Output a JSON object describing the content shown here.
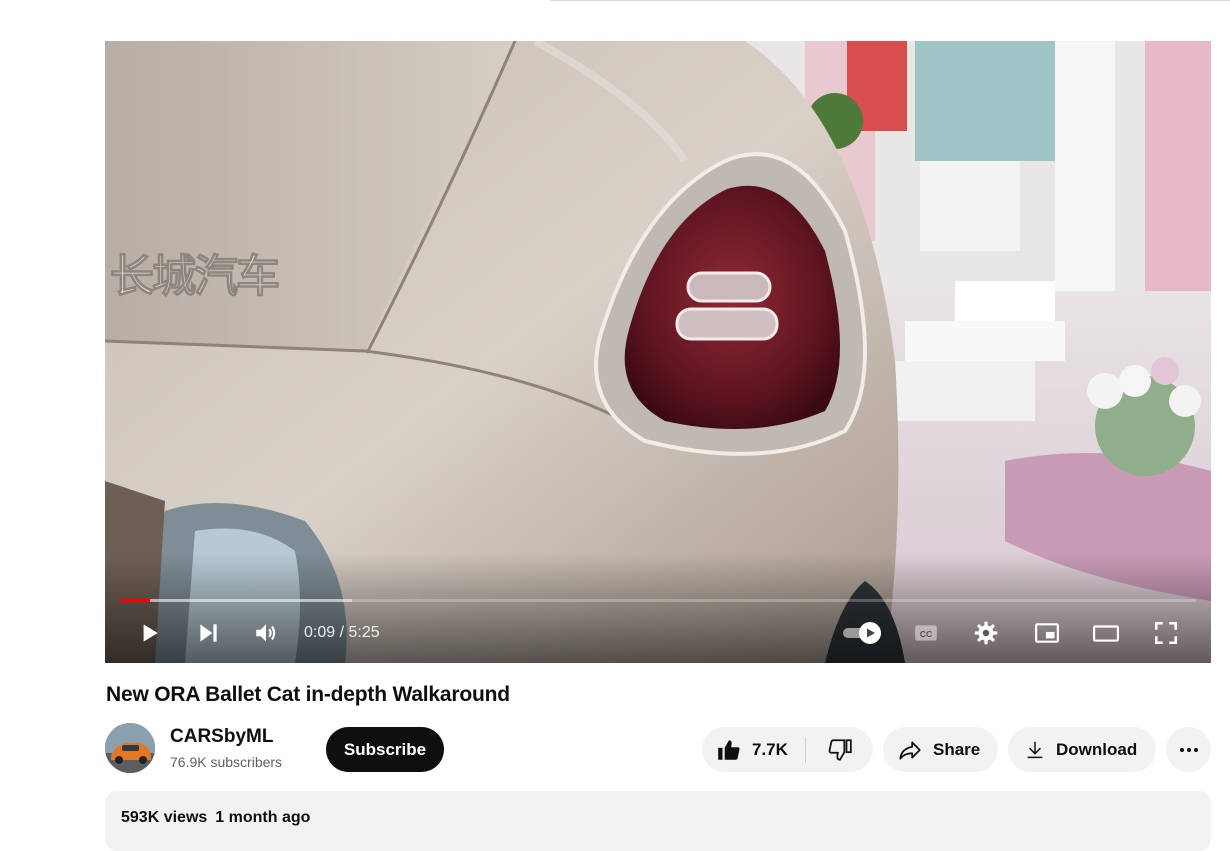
{
  "player": {
    "time_current": "0:09",
    "time_separator": " / ",
    "time_total": "5:25",
    "progress_played_fraction": 0.028,
    "progress_loaded_fraction": 0.216,
    "controls": {
      "play": "play-icon",
      "next": "next-icon",
      "volume": "volume-icon",
      "autoplay": "autoplay-toggle-icon",
      "captions": "captions-icon",
      "settings": "gear-icon",
      "miniplayer": "miniplayer-icon",
      "theater": "theater-mode-icon",
      "fullscreen": "fullscreen-icon"
    },
    "accent_color": "#ff0000"
  },
  "video": {
    "title": "New ORA Ballet Cat in-depth Walkaround"
  },
  "owner": {
    "channel_name": "CARSbyML",
    "subscribers": "76.9K subscribers",
    "subscribe_label": "Subscribe"
  },
  "actions": {
    "like_count": "7.7K",
    "share_label": "Share",
    "download_label": "Download",
    "like_icon": "thumbs-up-icon",
    "dislike_icon": "thumbs-down-icon",
    "share_icon": "share-arrow-icon",
    "download_icon": "download-icon",
    "more_icon": "more-horizontal-icon"
  },
  "description": {
    "views": "593K views",
    "age": "1 month ago"
  }
}
